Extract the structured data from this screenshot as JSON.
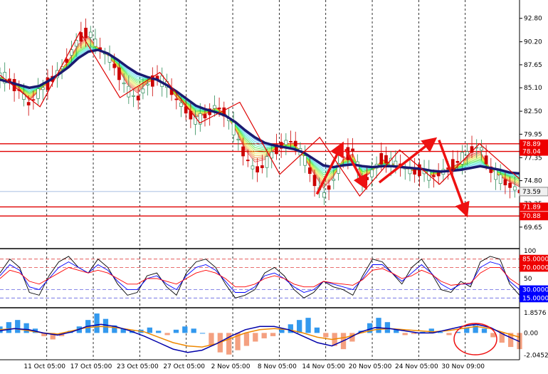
{
  "chart_data": [
    {
      "type": "line",
      "panel": "price",
      "ylim": [
        67.5,
        94.2
      ],
      "y_ticks": [
        "92.80",
        "90.20",
        "87.65",
        "85.10",
        "82.50",
        "79.95",
        "77.35",
        "74.80",
        "72.25",
        "69.65"
      ],
      "current_price": 73.59,
      "current_price_label": "73.59",
      "levels": [
        {
          "label": "78.89",
          "value": 78.89,
          "color": "#e00000"
        },
        {
          "label": "78.04",
          "value": 78.04,
          "color": "#e00000"
        },
        {
          "label": "71.89",
          "value": 71.89,
          "color": "#e00000"
        },
        {
          "label": "70.88",
          "value": 70.88,
          "color": "#e00000"
        }
      ],
      "price_series": [
        86.5,
        85.9,
        84.8,
        83.2,
        84.6,
        85.7,
        86.8,
        88.4,
        90.5,
        91.4,
        89.6,
        88.6,
        87.0,
        84.8,
        83.8,
        85.4,
        86.2,
        85.5,
        83.8,
        82.6,
        81.4,
        82.0,
        83.1,
        82.3,
        80.2,
        77.5,
        75.9,
        76.5,
        78.1,
        79.0,
        79.2,
        77.3,
        75.0,
        73.1,
        74.8,
        77.4,
        78.2,
        74.5,
        75.7,
        77.4,
        76.8,
        76.4,
        75.8,
        76.0,
        75.2,
        75.6,
        76.4,
        77.1,
        78.2,
        78.6,
        76.1,
        75.0,
        74.3,
        73.6
      ],
      "ma_series": [
        86.0,
        85.7,
        85.4,
        85.1,
        85.3,
        85.9,
        86.6,
        87.4,
        88.4,
        89.1,
        89.3,
        88.9,
        88.2,
        87.4,
        86.7,
        86.3,
        86.0,
        85.4,
        84.7,
        83.9,
        83.1,
        82.7,
        82.4,
        82.0,
        81.3,
        80.4,
        79.6,
        79.0,
        78.7,
        78.5,
        78.3,
        77.9,
        77.2,
        76.5,
        76.3,
        76.5,
        76.6,
        76.4,
        76.3,
        76.4,
        76.4,
        76.3,
        76.2,
        76.1,
        75.9,
        75.8,
        75.9,
        76.0,
        76.2,
        76.4,
        76.2,
        76.0,
        75.7,
        75.6
      ],
      "zigzag": [
        86.5,
        83.0,
        91.3,
        84.0,
        86.8,
        81.2,
        83.5,
        75.5,
        79.6,
        73.1,
        78.2,
        74.4,
        78.9,
        75.0
      ],
      "arrows": [
        {
          "from": [
            73.3,
            0.61
          ],
          "to": [
            78.4,
            0.655
          ]
        },
        {
          "from": [
            78.3,
            0.665
          ],
          "to": [
            74.5,
            0.7
          ]
        },
        {
          "from": [
            74.6,
            0.73
          ],
          "to": [
            79.1,
            0.83
          ]
        },
        {
          "from": [
            79.3,
            0.845
          ],
          "to": [
            71.5,
            0.895
          ]
        }
      ]
    },
    {
      "type": "line",
      "panel": "oscillator",
      "ylim": [
        0,
        100
      ],
      "y_ticks": [
        "100",
        "50"
      ],
      "levels": [
        {
          "label": "85.0000",
          "value": 85
        },
        {
          "label": "70.0000",
          "value": 70
        },
        {
          "label": "30.0000",
          "value": 30
        },
        {
          "label": "15.0000",
          "value": 15
        }
      ],
      "series": [
        {
          "color": "#000000",
          "values": [
            60,
            85,
            70,
            25,
            20,
            55,
            80,
            90,
            70,
            60,
            85,
            70,
            40,
            20,
            25,
            55,
            60,
            35,
            20,
            60,
            80,
            85,
            70,
            40,
            15,
            20,
            30,
            60,
            70,
            55,
            30,
            15,
            25,
            45,
            35,
            30,
            20,
            55,
            85,
            80,
            60,
            40,
            70,
            85,
            60,
            30,
            25,
            45,
            35,
            80,
            90,
            85,
            40,
            20
          ]
        },
        {
          "color": "#0000ff",
          "values": [
            55,
            75,
            65,
            35,
            30,
            50,
            70,
            80,
            70,
            60,
            75,
            65,
            45,
            30,
            30,
            50,
            55,
            40,
            30,
            55,
            70,
            75,
            65,
            45,
            25,
            25,
            35,
            55,
            60,
            50,
            35,
            25,
            30,
            45,
            40,
            35,
            30,
            50,
            75,
            75,
            60,
            45,
            60,
            75,
            60,
            40,
            30,
            40,
            40,
            70,
            80,
            75,
            45,
            30
          ]
        },
        {
          "color": "#ff0000",
          "values": [
            50,
            65,
            60,
            45,
            40,
            50,
            60,
            70,
            65,
            60,
            65,
            60,
            50,
            40,
            40,
            50,
            50,
            45,
            40,
            50,
            60,
            65,
            60,
            50,
            35,
            35,
            40,
            50,
            55,
            50,
            40,
            35,
            35,
            45,
            42,
            40,
            38,
            48,
            65,
            68,
            60,
            50,
            55,
            65,
            58,
            45,
            38,
            40,
            42,
            60,
            70,
            70,
            50,
            38
          ]
        }
      ]
    },
    {
      "type": "bar",
      "panel": "macd",
      "ylim": [
        -2.35,
        2.2
      ],
      "y_ticks": [
        "1.8576",
        "0.00",
        "-2.0452"
      ],
      "histogram": [
        0.6,
        1.0,
        1.2,
        0.9,
        0.4,
        -0.3,
        -0.6,
        -0.3,
        0.2,
        0.6,
        1.2,
        1.8,
        1.3,
        0.7,
        0.4,
        0.2,
        0.3,
        0.5,
        0.2,
        -0.2,
        0.3,
        0.6,
        0.4,
        0.0,
        -1.2,
        -1.8,
        -2.0,
        -1.6,
        -1.2,
        -0.8,
        -0.5,
        -0.3,
        0.4,
        0.8,
        1.2,
        1.4,
        0.5,
        -0.4,
        -1.2,
        -1.5,
        -0.8,
        0.2,
        0.9,
        1.4,
        1.0,
        0.3,
        -0.2,
        -0.1,
        0.1,
        0.4,
        0.1,
        -0.2,
        0.1,
        0.5,
        0.7,
        0.4,
        -0.4,
        -0.9,
        -1.3,
        -1.5
      ],
      "signal_series": [
        0.3,
        0.4,
        0.2,
        0.0,
        -0.1,
        0.2,
        0.5,
        0.6,
        0.5,
        0.3,
        0.1,
        -0.4,
        -0.9,
        -1.2,
        -1.3,
        -1.0,
        -0.5,
        0.0,
        0.3,
        0.4,
        0.3,
        0.0,
        -0.4,
        -0.6,
        -0.4,
        0.0,
        0.3,
        0.4,
        0.3,
        0.2,
        0.1,
        0.2,
        0.4,
        0.6,
        0.4,
        0.0,
        -0.4
      ],
      "macd_series": [
        0.2,
        0.4,
        0.3,
        0.0,
        -0.2,
        0.1,
        0.6,
        0.8,
        0.6,
        0.2,
        -0.3,
        -0.9,
        -1.5,
        -1.8,
        -1.6,
        -1.0,
        -0.3,
        0.3,
        0.6,
        0.6,
        0.3,
        -0.3,
        -0.9,
        -1.2,
        -0.6,
        0.1,
        0.5,
        0.4,
        0.2,
        0.0,
        0.0,
        0.3,
        0.6,
        0.8,
        0.5,
        -0.2,
        -0.8
      ]
    }
  ],
  "x_axis": {
    "labels": [
      "11 Oct 05:00",
      "17 Oct 05:00",
      "23 Oct 05:00",
      "27 Oct 05:00",
      "2 Nov 05:00",
      "8 Nov 05:00",
      "14 Nov 05:00",
      "20 Nov 05:00",
      "24 Nov 05:00",
      "30 Nov 09:00"
    ]
  },
  "colors": {
    "bull_candle": "#2e8b57",
    "bear_candle": "#cc0000",
    "ma_thick": "#1a1a70",
    "zigzag": "#dd0000",
    "arrow": "#ee1111",
    "hist_positive": "#3399ee",
    "hist_negative": "#f4a080",
    "macd_line": "#0000aa",
    "signal_line": "#ee8800",
    "level_tag": "#ee0000",
    "low_level_tag": "#0000ff"
  }
}
